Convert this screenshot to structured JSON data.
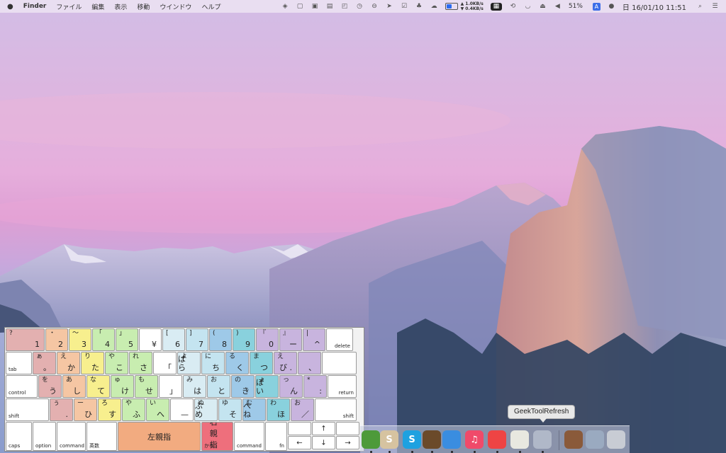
{
  "menubar": {
    "apple": "",
    "app_name": "Finder",
    "items": [
      "ファイル",
      "編集",
      "表示",
      "移動",
      "ウインドウ",
      "ヘルプ"
    ],
    "network_up": "▲ 1.0KB/s",
    "network_down": "▼ 0.4KB/s",
    "battery_percent_label": "51%",
    "battery_level": 0.51,
    "input_source": "A",
    "clock": "日 16/01/10  11:51",
    "icons": [
      "dropbox-icon",
      "window-icon",
      "display-icon",
      "clipboard-icon",
      "screenshot-icon",
      "clock-icon",
      "stop-icon",
      "location-icon",
      "check-icon",
      "evernote-icon",
      "cloud-icon",
      "istat-icon",
      "time-machine-icon",
      "wifi-icon",
      "eject-icon",
      "volume-icon",
      "user-icon",
      "spotlight-icon",
      "notification-icon"
    ]
  },
  "keyboard": {
    "rows": [
      [
        {
          "top": "?",
          "bottom": "1",
          "color": "#e3b0b0",
          "w": 56
        },
        {
          "top": "・",
          "bottom": "2",
          "color": "#f5c6a3",
          "w": 33
        },
        {
          "top": "〜",
          "bottom": "3",
          "color": "#f7ef8e",
          "w": 33
        },
        {
          "top": "「",
          "bottom": "4",
          "color": "#c8edb0",
          "w": 33
        },
        {
          "top": "」",
          "bottom": "5",
          "color": "#c8edb0",
          "w": 33
        },
        {
          "top": "",
          "bottom": "¥",
          "color": "#ffffff",
          "w": 33
        },
        {
          "top": "[",
          "bottom": "6",
          "color": "#d9ecf3",
          "w": 33
        },
        {
          "top": "]",
          "bottom": "7",
          "color": "#c4e4f0",
          "w": 33
        },
        {
          "top": "(",
          "bottom": "8",
          "color": "#9ec9e8",
          "w": 33
        },
        {
          "top": ")",
          "bottom": "9",
          "color": "#89d1dd",
          "w": 33
        },
        {
          "top": "『",
          "bottom": "0",
          "color": "#c8b4de",
          "w": 33
        },
        {
          "top": "』",
          "bottom": "ー",
          "color": "#c8b4de",
          "w": 33
        },
        {
          "top": "|",
          "bottom": "^",
          "color": "#c8b4de",
          "w": 33
        },
        {
          "top": "",
          "bottom": "delete",
          "color": "#ffffff",
          "w": 39,
          "small": true
        }
      ],
      [
        {
          "top": "",
          "bottom": "tab",
          "color": "#ffffff",
          "w": 38,
          "small": true,
          "left": true
        },
        {
          "top": "ぁ",
          "bottom": "。",
          "color": "#e3b0b0",
          "w": 34
        },
        {
          "top": "え",
          "bottom": "か",
          "color": "#f5c6a3",
          "w": 34
        },
        {
          "top": "り",
          "bottom": "た",
          "color": "#f7ef8e",
          "w": 34
        },
        {
          "top": "や",
          "bottom": "こ",
          "color": "#c8edb0",
          "w": 34
        },
        {
          "top": "れ",
          "bottom": "さ",
          "color": "#c8edb0",
          "w": 34
        },
        {
          "top": "",
          "bottom": "「",
          "color": "#ffffff",
          "w": 34
        },
        {
          "top": "よ",
          "bottom": "ぱ ら",
          "color": "#d9ecf3",
          "w": 34
        },
        {
          "top": "に",
          "bottom": "ち",
          "color": "#c4e4f0",
          "w": 34
        },
        {
          "top": "る",
          "bottom": "く",
          "color": "#9ec9e8",
          "w": 34
        },
        {
          "top": "ま",
          "bottom": "つ",
          "color": "#89d1dd",
          "w": 34
        },
        {
          "top": "え",
          "bottom": "び .",
          "color": "#c8b4de",
          "w": 34
        },
        {
          "top": "",
          "bottom": "、",
          "color": "#c8b4de",
          "w": 34
        },
        {
          "top": "",
          "bottom": "",
          "color": "#ffffff",
          "w": 50
        }
      ],
      [
        {
          "top": "",
          "bottom": "control",
          "color": "#ffffff",
          "w": 46,
          "small": true,
          "left": true
        },
        {
          "top": "を",
          "bottom": "う",
          "color": "#e3b0b0",
          "w": 34
        },
        {
          "top": "あ",
          "bottom": "し",
          "color": "#f5c6a3",
          "w": 34
        },
        {
          "top": "な",
          "bottom": "て",
          "color": "#f7ef8e",
          "w": 34
        },
        {
          "top": "ゅ",
          "bottom": "け",
          "color": "#c8edb0",
          "w": 34
        },
        {
          "top": "も",
          "bottom": "せ",
          "color": "#c8edb0",
          "w": 34
        },
        {
          "top": "",
          "bottom": "」",
          "color": "#ffffff",
          "w": 34
        },
        {
          "top": "み",
          "bottom": "は",
          "color": "#d9ecf3",
          "w": 34
        },
        {
          "top": "お",
          "bottom": "と",
          "color": "#c4e4f0",
          "w": 34
        },
        {
          "top": "の",
          "bottom": "き",
          "color": "#9ec9e8",
          "w": 34
        },
        {
          "top": "ょ",
          "bottom": "ぽ い",
          "color": "#89d1dd",
          "w": 34
        },
        {
          "top": "っ",
          "bottom": "ん",
          "color": "#c8b4de",
          "w": 34
        },
        {
          "top": "*",
          "bottom": ":",
          "color": "#c8b4de",
          "w": 34
        },
        {
          "top": "",
          "bottom": "return",
          "color": "#ffffff",
          "w": 42,
          "small": true
        }
      ],
      [
        {
          "top": "",
          "bottom": "shift",
          "color": "#ffffff",
          "w": 62,
          "small": true,
          "left": true
        },
        {
          "top": "ぅ",
          "bottom": ".",
          "color": "#e3b0b0",
          "w": 34
        },
        {
          "top": "ー",
          "bottom": "ひ",
          "color": "#f5c6a3",
          "w": 34
        },
        {
          "top": "ろ",
          "bottom": "す",
          "color": "#f7ef8e",
          "w": 34
        },
        {
          "top": "や",
          "bottom": "ふ",
          "color": "#c8edb0",
          "w": 34
        },
        {
          "top": "い",
          "bottom": "へ",
          "color": "#c8edb0",
          "w": 34
        },
        {
          "top": "",
          "bottom": "—",
          "color": "#ffffff",
          "w": 34
        },
        {
          "top": "ぬ",
          "bottom": "ぶ め",
          "color": "#d9ecf3",
          "w": 34
        },
        {
          "top": "ゆ",
          "bottom": "そ",
          "color": "#c4e4f0",
          "w": 34
        },
        {
          "top": "む",
          "bottom": "べ ね",
          "color": "#9ec9e8",
          "w": 34
        },
        {
          "top": "わ",
          "bottom": "ほ",
          "color": "#89d1dd",
          "w": 34
        },
        {
          "top": "お",
          "bottom": "／",
          "color": "#c8b4de",
          "w": 34
        },
        {
          "top": "",
          "bottom": "shift",
          "color": "#ffffff",
          "w": 60,
          "small": true
        }
      ]
    ],
    "bottom_row": {
      "caps": "caps",
      "option": "option",
      "command": "command",
      "eisu": "英数",
      "left_thumb": "左親指",
      "right_thumb": "右親指",
      "kana": "かな",
      "command_right": "command",
      "fn": "fn",
      "arrow_up": "↑",
      "arrow_left": "←",
      "arrow_down": "↓",
      "arrow_right": "→"
    }
  },
  "dock": {
    "tooltip": "GeekToolRefresh",
    "apps": [
      {
        "name": "evernote-app",
        "glyph": "",
        "color": "#4d9a3a"
      },
      {
        "name": "slack-app",
        "glyph": "S",
        "color": "#d6c3a0"
      },
      {
        "name": "skype-app",
        "glyph": "S",
        "color": "#1ea1e0"
      },
      {
        "name": "hootsuite-app",
        "glyph": "",
        "color": "#6b4a2a"
      },
      {
        "name": "paper-plane-app",
        "glyph": "",
        "color": "#3a8de0"
      },
      {
        "name": "itunes-app",
        "glyph": "♫",
        "color": "#f04a6a"
      },
      {
        "name": "chrome-app",
        "glyph": "",
        "color": "#e44"
      },
      {
        "name": "textedit-app",
        "glyph": "",
        "color": "#e8e8e0"
      },
      {
        "name": "geektool-app",
        "glyph": "",
        "color": "#b0b8c8"
      },
      {
        "name": "notebook-app",
        "glyph": "",
        "color": "#8a5a3a"
      },
      {
        "name": "preview-app",
        "glyph": "",
        "color": "#9aaac0"
      },
      {
        "name": "trash",
        "glyph": "",
        "color": "#c8ccd4"
      }
    ]
  }
}
